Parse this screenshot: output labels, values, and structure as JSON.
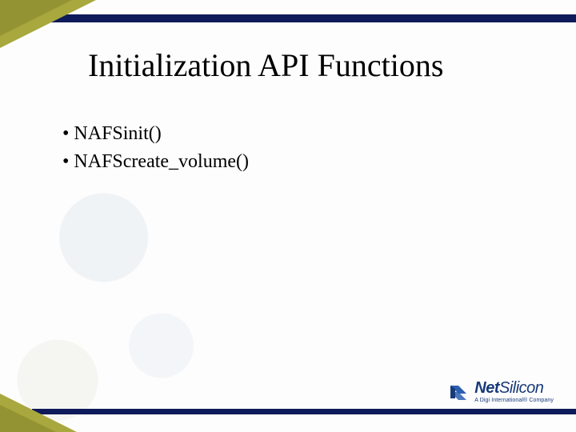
{
  "title": "Initialization API Functions",
  "bullets": [
    "NAFSinit()",
    "NAFScreate_volume()"
  ],
  "logo": {
    "name_bold": "Net",
    "name_light": "Silicon",
    "tagline": "A Digi International® Company"
  },
  "colors": {
    "navy": "#0e1a5a",
    "olive": "#a9a83e",
    "logo_blue": "#173a7a"
  }
}
